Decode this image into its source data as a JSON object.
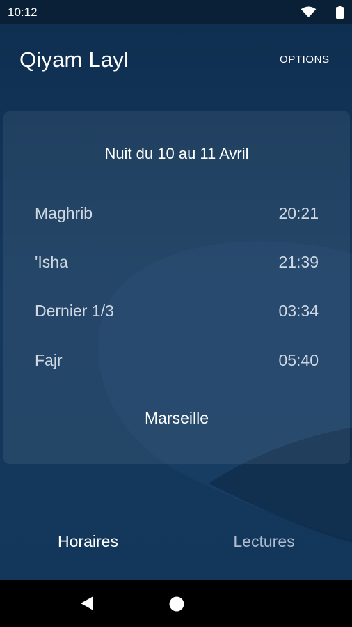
{
  "status_bar": {
    "time": "10:12",
    "icons": [
      "wifi-icon",
      "battery-icon"
    ]
  },
  "app": {
    "title": "Qiyam Layl",
    "options_label": "OPTIONS"
  },
  "card": {
    "night_title": "Nuit du 10 au 11 Avril",
    "prayers": [
      {
        "name": "Maghrib",
        "time": "20:21"
      },
      {
        "name": "'Isha",
        "time": "21:39"
      },
      {
        "name": "Dernier 1/3",
        "time": "03:34"
      },
      {
        "name": "Fajr",
        "time": "05:40"
      }
    ],
    "city": "Marseille"
  },
  "tabs": [
    {
      "label": "Horaires",
      "active": true
    },
    {
      "label": "Lectures",
      "active": false
    }
  ],
  "nav": {
    "icons": [
      "back-icon",
      "home-icon"
    ]
  },
  "colors": {
    "background": "#0f2f51",
    "card": "#1f4266",
    "active_tab": "#ffffff",
    "inactive_tab": "#aebbd0"
  }
}
